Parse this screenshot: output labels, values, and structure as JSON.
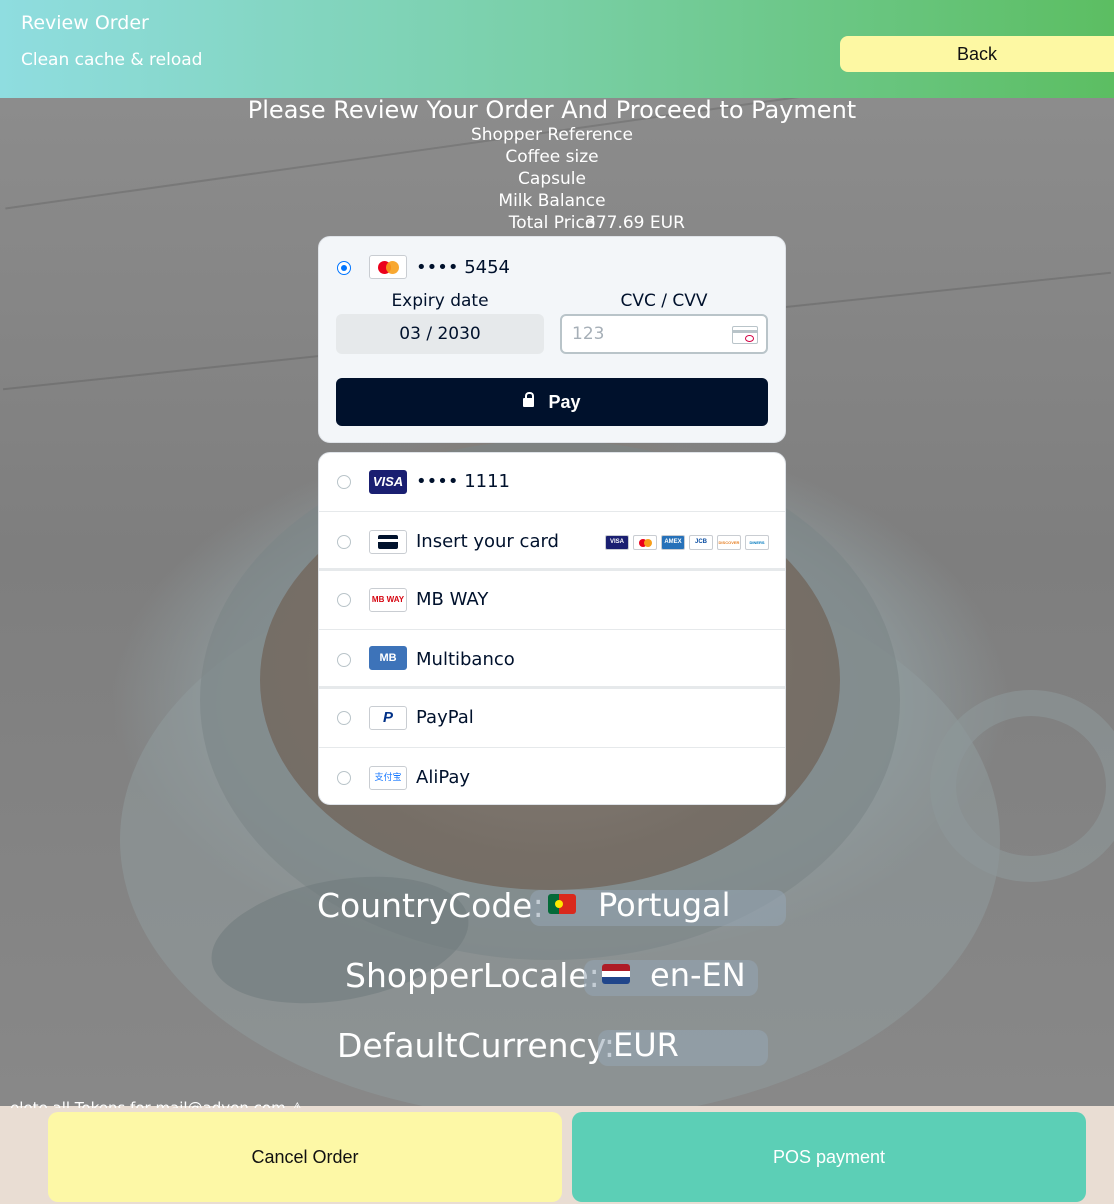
{
  "header": {
    "title": "Review Order",
    "reload_label": "Clean cache & reload",
    "back_label": "Back"
  },
  "summary": {
    "heading": "Please Review Your Order And Proceed to Payment",
    "shopper_reference_label": "Shopper Reference",
    "coffee_size_label": "Coffee size",
    "capsule_label": "Capsule",
    "milk_balance_label": "Milk Balance",
    "total_price_label": "Total Price",
    "total_price_value": "377.69 EUR"
  },
  "payment": {
    "selected": {
      "brand": "mastercard",
      "card_number": "•••• 5454",
      "expiry_label": "Expiry date",
      "expiry_value": "03 / 2030",
      "cvc_label": "CVC / CVV",
      "cvc_placeholder": "123",
      "pay_label": "Pay"
    },
    "methods": [
      {
        "name": "visa-saved",
        "label": "•••• 1111",
        "brand_text": "VISA"
      },
      {
        "name": "insert-card",
        "label": "Insert your card",
        "brand_logos": [
          "VISA",
          "MC",
          "AMEX",
          "JCB",
          "DISCOVER",
          "DINERS"
        ]
      },
      {
        "name": "mbway",
        "label": "MB WAY",
        "brand_text": "MB WAY"
      },
      {
        "name": "multibanco",
        "label": "Multibanco",
        "brand_text": "MB"
      },
      {
        "name": "paypal",
        "label": "PayPal",
        "brand_text": "P"
      },
      {
        "name": "alipay",
        "label": "AliPay",
        "brand_text": "支付宝"
      }
    ]
  },
  "config": {
    "country_code_label": "CountryCode:",
    "country_value": "Portugal",
    "shopper_locale_label": "ShopperLocale:",
    "locale_value": "en-EN",
    "default_currency_label": "DefaultCurrency:",
    "currency_value": "EUR"
  },
  "delete_note": "elete all Tokens for mail@adyen.com ⚠",
  "footer": {
    "cancel_label": "Cancel Order",
    "pos_label": "POS payment"
  },
  "colors": {
    "header_gradient_start": "#8fdde0",
    "header_gradient_end": "#5cbe62",
    "back_button": "#fdf8a3",
    "pay_button": "#00112c",
    "cancel_button": "#fdf8a6",
    "pos_button": "#5ccfb6"
  }
}
